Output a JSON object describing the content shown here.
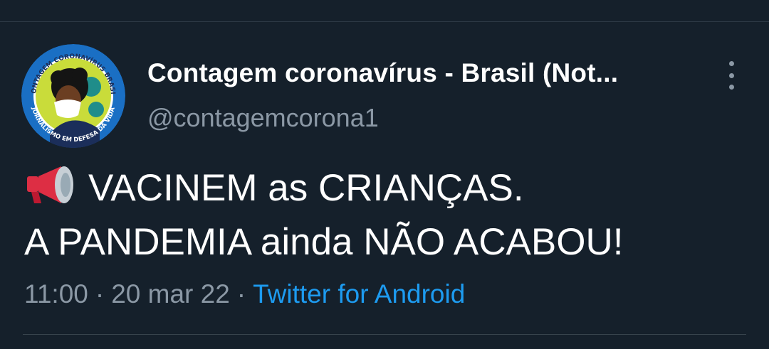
{
  "tweet": {
    "author": {
      "display_name": "Contagem coronavírus - Brasil (Not...",
      "handle": "@contagemcorona1",
      "avatar": {
        "top_text": "CONTAGEM CORONAVÍRUS BRASIL",
        "bottom_text": "JORNALISMO EM DEFESA DA VIDA"
      }
    },
    "text_line_1": "VACINEM as CRIANÇAS.",
    "text_line_2": "A PANDEMIA ainda NÃO ACABOU!",
    "emoji": "megaphone-icon",
    "time": "11:00",
    "separator": "·",
    "date": "20 mar 22",
    "source": "Twitter for Android"
  },
  "colors": {
    "background": "#15202b",
    "text_primary": "#ffffff",
    "text_secondary": "#8b98a5",
    "link": "#1d9bf0"
  }
}
